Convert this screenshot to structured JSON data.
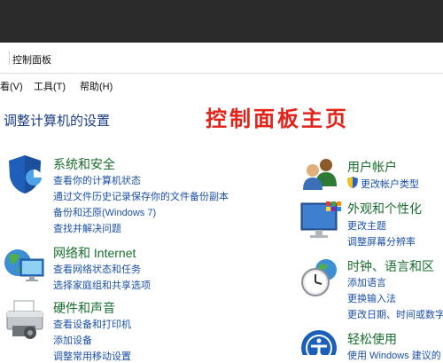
{
  "breadcrumb": "控制面板",
  "menu": {
    "view": "看(V)",
    "tools": "工具(T)",
    "help": "帮助(H)"
  },
  "page_heading": "调整计算机的设置",
  "overlay_title": "控制面板主页",
  "colors": {
    "title_bar": "#2b2b2b",
    "category_title": "#186d2e",
    "link": "#1a4fa8",
    "overlay": "#e2231a"
  },
  "categories": {
    "system_security": {
      "icon": "shield-icon",
      "title": "系统和安全",
      "links": [
        "查看你的计算机状态",
        "通过文件历史记录保存你的文件备份副本",
        "备份和还原(Windows 7)",
        "查找并解决问题"
      ]
    },
    "network": {
      "icon": "network-globe-icon",
      "title": "网络和 Internet",
      "links": [
        "查看网络状态和任务",
        "选择家庭组和共享选项"
      ]
    },
    "hardware": {
      "icon": "printer-icon",
      "title": "硬件和声音",
      "links": [
        "查看设备和打印机",
        "添加设备",
        "调整常用移动设置"
      ]
    },
    "user_accounts": {
      "icon": "users-icon",
      "title": "用户帐户",
      "links": [
        "更改帐户类型"
      ]
    },
    "appearance": {
      "icon": "monitor-colors-icon",
      "title": "外观和个性化",
      "links": [
        "更改主题",
        "调整屏幕分辨率"
      ]
    },
    "clock_region": {
      "icon": "clock-globe-icon",
      "title": "时钟、语言和区",
      "links": [
        "添加语言",
        "更换输入法",
        "更改日期、时间或数字"
      ]
    },
    "ease_of_access": {
      "icon": "ease-of-access-icon",
      "title": "轻松使用",
      "links": [
        "使用 Windows 建议的"
      ]
    }
  }
}
